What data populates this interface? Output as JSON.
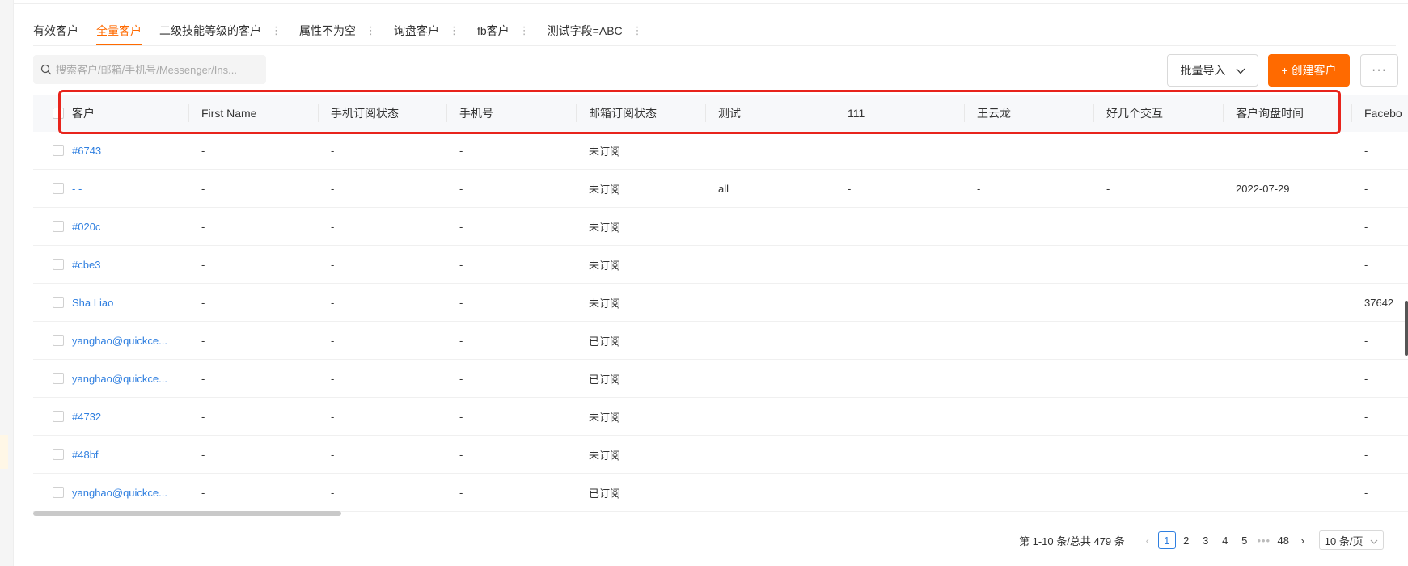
{
  "tabs": [
    {
      "label": "有效客户",
      "active": false,
      "menu": false
    },
    {
      "label": "全量客户",
      "active": true,
      "menu": false
    },
    {
      "label": "二级技能等级的客户",
      "active": false,
      "menu": true
    },
    {
      "label": "属性不为空",
      "active": false,
      "menu": true
    },
    {
      "label": "询盘客户",
      "active": false,
      "menu": true
    },
    {
      "label": "fb客户",
      "active": false,
      "menu": true
    },
    {
      "label": "测试字段=ABC",
      "active": false,
      "menu": true
    }
  ],
  "search": {
    "placeholder": "搜索客户/邮箱/手机号/Messenger/Ins..."
  },
  "toolbar": {
    "import_label": "批量导入",
    "create_label": "+ 创建客户",
    "more_label": "···"
  },
  "table": {
    "columns": [
      "客户",
      "First Name",
      "手机订阅状态",
      "手机号",
      "邮箱订阅状态",
      "测试",
      "111",
      "王云龙",
      "好几个交互",
      "客户询盘时间",
      "Facebo"
    ],
    "rows": [
      [
        "#6743",
        "-",
        "-",
        "-",
        "未订阅",
        "",
        "",
        "",
        "",
        "",
        "-"
      ],
      [
        "- -",
        "-",
        "-",
        "-",
        "未订阅",
        "all",
        "-",
        "-",
        "-",
        "2022-07-29",
        "-"
      ],
      [
        "#020c",
        "-",
        "-",
        "-",
        "未订阅",
        "",
        "",
        "",
        "",
        "",
        "-"
      ],
      [
        "#cbe3",
        "-",
        "-",
        "-",
        "未订阅",
        "",
        "",
        "",
        "",
        "",
        "-"
      ],
      [
        "Sha Liao",
        "-",
        "-",
        "-",
        "未订阅",
        "",
        "",
        "",
        "",
        "",
        "37642"
      ],
      [
        "yanghao@quickce...",
        "-",
        "-",
        "-",
        "已订阅",
        "",
        "",
        "",
        "",
        "",
        "-"
      ],
      [
        "yanghao@quickce...",
        "-",
        "-",
        "-",
        "已订阅",
        "",
        "",
        "",
        "",
        "",
        "-"
      ],
      [
        "#4732",
        "-",
        "-",
        "-",
        "未订阅",
        "",
        "",
        "",
        "",
        "",
        "-"
      ],
      [
        "#48bf",
        "-",
        "-",
        "-",
        "未订阅",
        "",
        "",
        "",
        "",
        "",
        "-"
      ],
      [
        "yanghao@quickce...",
        "-",
        "-",
        "-",
        "已订阅",
        "",
        "",
        "",
        "",
        "",
        "-"
      ]
    ]
  },
  "pagination": {
    "total_text": "第 1-10 条/总共 479 条",
    "pages": [
      "1",
      "2",
      "3",
      "4",
      "5",
      "•••",
      "48"
    ],
    "current": "1",
    "page_size": "10 条/页"
  },
  "colors": {
    "accent": "#ff6a00",
    "link": "#2f7fe0",
    "highlight": "#e8241c"
  }
}
